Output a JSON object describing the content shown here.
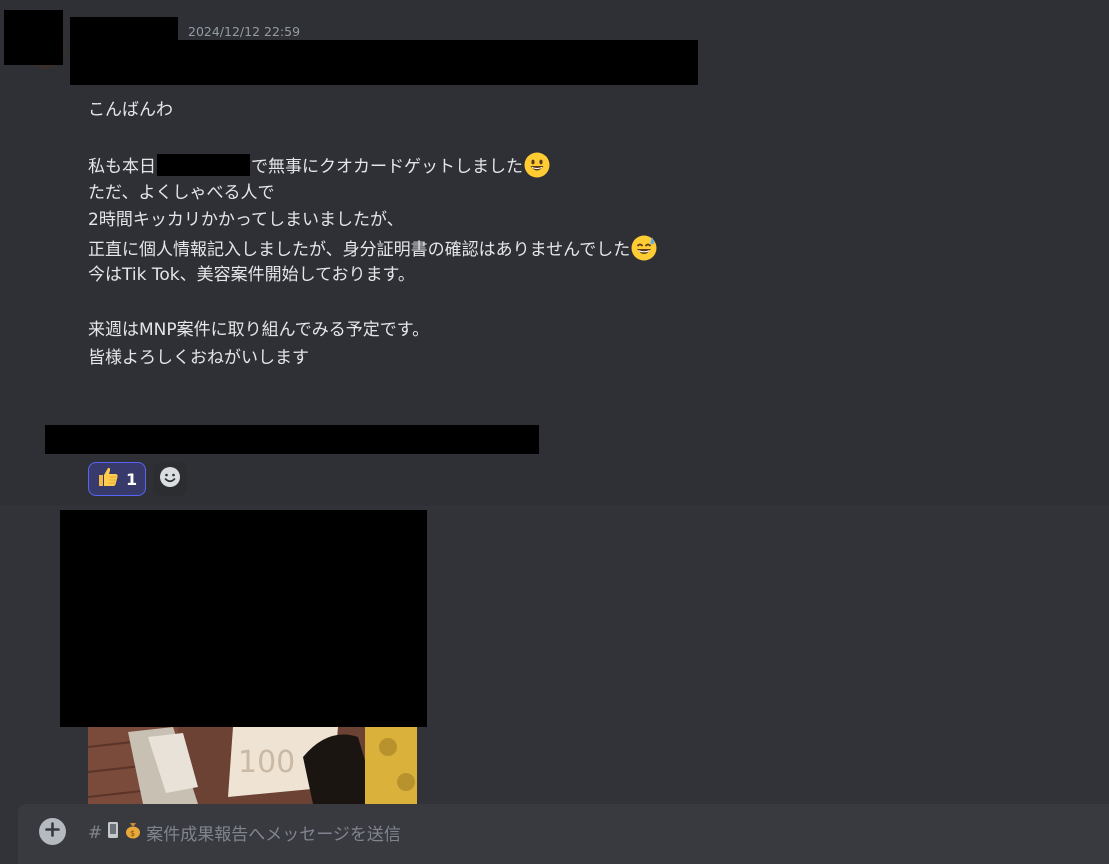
{
  "message": {
    "timestamp": "2024/12/12 22:59",
    "lines": [
      "こんばんわ",
      "",
      "私も本日",
      "で無事にクオカードゲットしました",
      "ただ、よくしゃべる人で",
      "2時間キッカリかかってしまいましたが、",
      "正直に個人情報記入しましたが、身分証明書の確認はありませんでした",
      "今はTik Tok、美容案件開始しております。",
      "",
      "来週はMNP案件に取り組んでみる予定です。",
      "皆様よろしくおねがいします"
    ]
  },
  "reactions": [
    {
      "emoji": "thumbs-up",
      "count": "1",
      "selected": true
    }
  ],
  "composer": {
    "channel_prefix": "#",
    "placeholder": "案件成果報告へメッセージを送信"
  },
  "colors": {
    "background": "#313338",
    "accent": "#5865f2"
  }
}
